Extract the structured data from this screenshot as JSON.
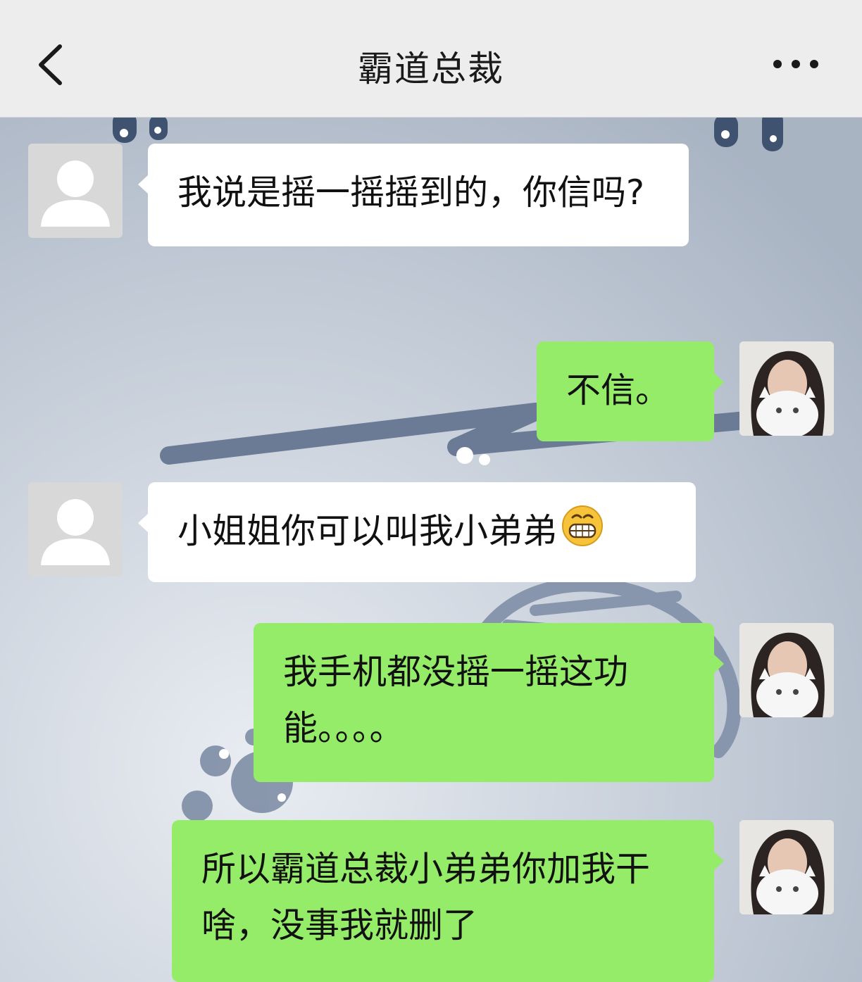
{
  "header": {
    "title": "霸道总裁",
    "back_icon": "chevron-left-icon",
    "more_icon": "more-dots-icon"
  },
  "messages": [
    {
      "side": "incoming",
      "text": "我说是摇一摇摇到的，你信吗?"
    },
    {
      "side": "outgoing",
      "text": "不信。"
    },
    {
      "side": "incoming",
      "text": "小姐姐你可以叫我小弟弟",
      "emoji": "grinning-face-emoji"
    },
    {
      "side": "outgoing",
      "text": "我手机都没摇一摇这功能。。。。"
    },
    {
      "side": "outgoing",
      "text": "所以霸道总裁小弟弟你加我干啥，没事我就删了"
    }
  ],
  "colors": {
    "header_bg": "#ededed",
    "chat_bg": "#b9c3cf",
    "incoming_bubble": "#ffffff",
    "outgoing_bubble": "#95ec69"
  }
}
